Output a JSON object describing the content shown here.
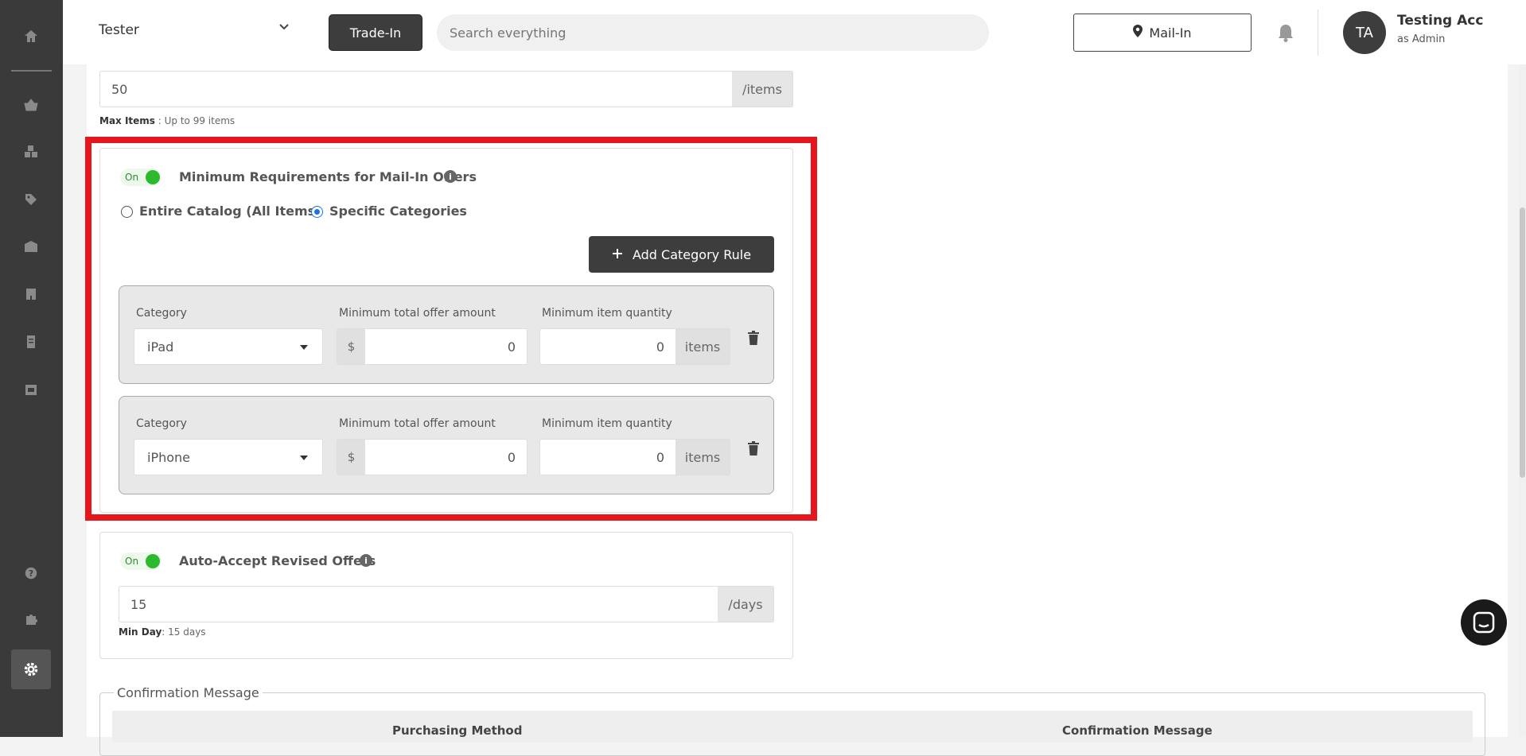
{
  "header": {
    "store": "Tester",
    "trade_in_label": "Trade-In",
    "search_placeholder": "Search everything",
    "location_label": "Mail-In",
    "user_initials": "TA",
    "user_name": "Testing Acc",
    "user_role": "as Admin"
  },
  "sidebar": {
    "items": [
      "home-icon",
      "basket-icon",
      "boxes-icon",
      "tag-icon",
      "warehouse-icon",
      "building-icon",
      "receipt-icon",
      "store-icon",
      "help-icon",
      "puzzle-icon",
      "settings-icon"
    ],
    "active": "settings-icon"
  },
  "max_items": {
    "value": "50",
    "suffix": "/items",
    "hint_label": "Max Items",
    "hint_text": " : Up to 99 items"
  },
  "min_requirements": {
    "toggle_label": "On",
    "title": "Minimum Requirements for Mail-In Offers",
    "info": "i",
    "radio_entire": "Entire Catalog (All Items)",
    "radio_specific": "Specific Categories",
    "selected": "Specific Categories",
    "add_button": "Add Category Rule",
    "col_category": "Category",
    "col_amount": "Minimum total offer amount",
    "col_qty": "Minimum item quantity",
    "currency": "$",
    "qty_suffix": "items",
    "rules": [
      {
        "category": "iPad",
        "amount": "0",
        "qty": "0"
      },
      {
        "category": "iPhone",
        "amount": "0",
        "qty": "0"
      }
    ]
  },
  "auto_accept": {
    "toggle_label": "On",
    "title": "Auto-Accept Revised Offers",
    "info": "i",
    "value": "15",
    "suffix": "/days",
    "hint_label": "Min Day",
    "hint_text": ": 15 days"
  },
  "confirmation": {
    "legend": "Confirmation Message",
    "col_method": "Purchasing Method",
    "col_message": "Confirmation Message"
  },
  "colors": {
    "highlight": "#e5161c",
    "toggle_on": "#2db92d",
    "dark": "#3d3d3d"
  }
}
